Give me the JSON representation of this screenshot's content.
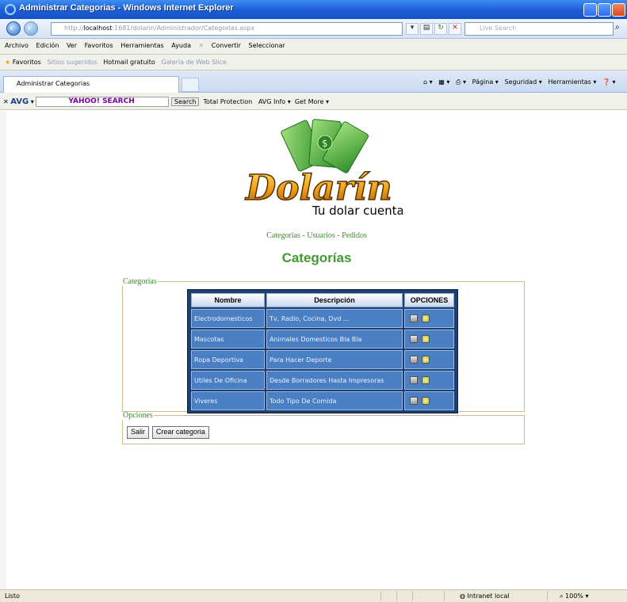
{
  "window": {
    "title": "Administrar Categorias - Windows Internet Explorer"
  },
  "addressbar": {
    "url_prefix": "http://",
    "url_host": "localhost",
    "url_rest": ":1681/dolarin/Administrador/Categorias.aspx",
    "search_placeholder": "Live Search"
  },
  "menubar": {
    "items": [
      "Archivo",
      "Edición",
      "Ver",
      "Favoritos",
      "Herramientas",
      "Ayuda"
    ],
    "convert": "Convertir",
    "select": "Seleccionar"
  },
  "favbar": {
    "favorites": "Favoritos",
    "suggested": "Sitios sugeridos",
    "hotmail": "Hotmail gratuito",
    "webslice": "Galería de Web Slice"
  },
  "tab": {
    "label": "Administrar Categorias"
  },
  "cmdbar": {
    "page": "Página",
    "security": "Seguridad",
    "tools": "Herramientas"
  },
  "avgbar": {
    "brand": "AVG",
    "yahoo": "YAHOO! SEARCH",
    "search": "Search",
    "protection": "Total Protection",
    "info": "AVG Info",
    "more": "Get More"
  },
  "logo": {
    "name": "Dolarín",
    "tagline": "Tu dolar cuenta"
  },
  "nav": {
    "categorias": "Categorias",
    "usuarios": "Usuarios",
    "pedidos": "Pedidos",
    "sep": " - "
  },
  "page": {
    "title": "Categorías"
  },
  "categorias_fieldset": {
    "legend": "Categorias"
  },
  "opciones_fieldset": {
    "legend": "Opciones"
  },
  "table": {
    "headers": [
      "Nombre",
      "Descripción",
      "OPCIONES"
    ],
    "rows": [
      {
        "nombre": "Electrodomesticos",
        "descripcion": "Tv, Radio, Cocina, Dvd ..."
      },
      {
        "nombre": "Mascotas",
        "descripcion": "Animales Domesticos Bla Bla"
      },
      {
        "nombre": "Ropa Deportiva",
        "descripcion": "Para Hacer Deporte"
      },
      {
        "nombre": "Utiles De Oficina",
        "descripcion": "Desde Borradores Hasta Impresoras"
      },
      {
        "nombre": "Viveres",
        "descripcion": "Todo Tipo De Comida"
      }
    ]
  },
  "buttons": {
    "salir": "Salir",
    "crear": "Crear categoria"
  },
  "status": {
    "left": "Listo",
    "zone": "Intranet local",
    "zoom": "100%"
  },
  "colors": {
    "accent_green": "#3f9b2f",
    "grid_blue": "#4b7fc4",
    "grid_border": "#1f3f6e"
  }
}
